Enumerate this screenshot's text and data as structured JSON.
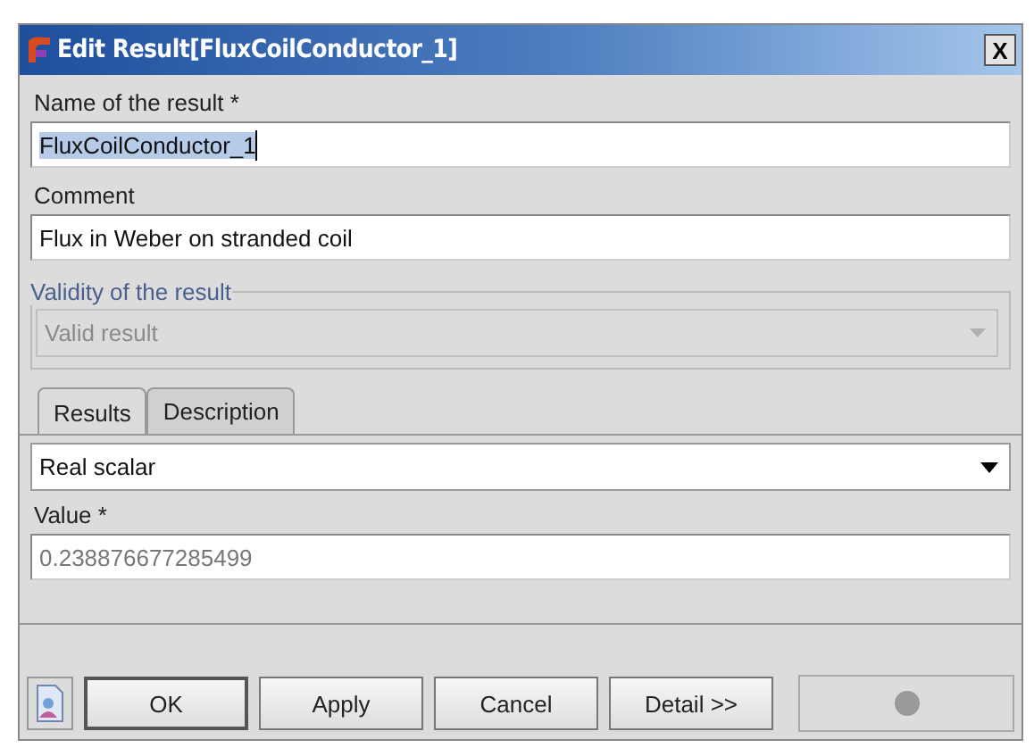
{
  "window": {
    "title": "Edit Result[FluxCoilConductor_1]",
    "close": "X"
  },
  "name_field": {
    "label": "Name of the result *",
    "value": "FluxCoilConductor_1",
    "text_selected": true
  },
  "comment_field": {
    "label": "Comment",
    "value": "Flux in Weber on stranded coil"
  },
  "validity": {
    "legend": "Validity of the result",
    "value": "Valid result",
    "disabled": true
  },
  "tabs": [
    {
      "label": "Results",
      "selected": true
    },
    {
      "label": "Description",
      "selected": false
    }
  ],
  "result_type": {
    "value": "Real scalar",
    "disabled": false
  },
  "value_field": {
    "label": "Value *",
    "value": "0.238876677285499",
    "disabled": true
  },
  "buttons": [
    {
      "label": "OK",
      "default": true
    },
    {
      "label": "Apply",
      "default": false
    },
    {
      "label": "Cancel",
      "default": false
    },
    {
      "label": "Detail >>",
      "default": false
    }
  ]
}
